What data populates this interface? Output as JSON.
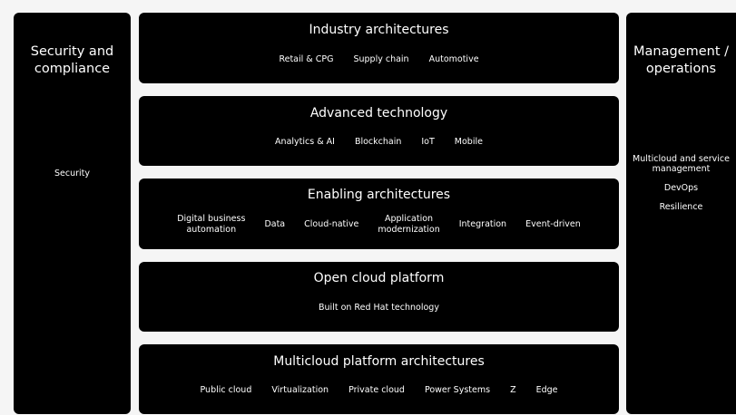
{
  "left_panel": {
    "title_line1": "Security and",
    "title_line2": "compliance",
    "items": [
      "Security"
    ]
  },
  "right_panel": {
    "title_line1": "Management /",
    "title_line2": "operations",
    "items": [
      {
        "line1": "Multicloud and service",
        "line2": "management"
      },
      {
        "line1": "DevOps"
      },
      {
        "line1": "Resilience"
      }
    ]
  },
  "layers": [
    {
      "title": "Industry architectures",
      "items": [
        {
          "line1": "Retail & CPG"
        },
        {
          "line1": "Supply chain"
        },
        {
          "line1": "Automotive"
        }
      ]
    },
    {
      "title": "Advanced technology",
      "items": [
        {
          "line1": "Analytics & AI"
        },
        {
          "line1": "Blockchain"
        },
        {
          "line1": "IoT"
        },
        {
          "line1": "Mobile"
        }
      ]
    },
    {
      "title": "Enabling architectures",
      "items": [
        {
          "line1": "Digital business",
          "line2": "automation"
        },
        {
          "line1": "Data"
        },
        {
          "line1": "Cloud-native"
        },
        {
          "line1": "Application",
          "line2": "modernization"
        },
        {
          "line1": "Integration"
        },
        {
          "line1": "Event-driven"
        }
      ]
    },
    {
      "title": "Open cloud platform",
      "items": [
        {
          "line1": "Built on Red Hat technology"
        }
      ]
    },
    {
      "title": "Multicloud platform architectures",
      "items": [
        {
          "line1": "Public cloud"
        },
        {
          "line1": "Virtualization"
        },
        {
          "line1": "Private cloud"
        },
        {
          "line1": "Power Systems"
        },
        {
          "line1": "Z"
        },
        {
          "line1": "Edge"
        }
      ]
    }
  ]
}
